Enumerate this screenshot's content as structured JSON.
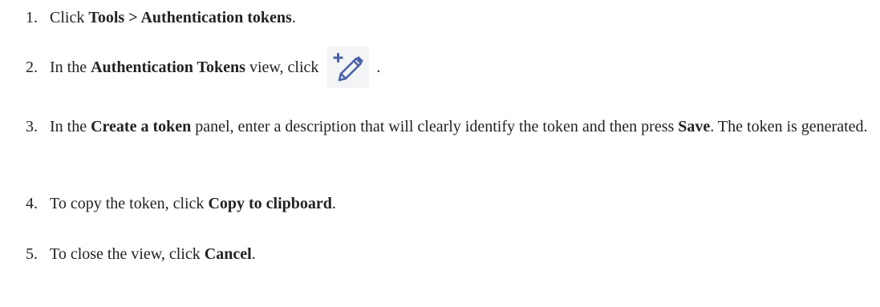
{
  "steps": [
    {
      "number": "1.",
      "parts": [
        "Click ",
        "Tools",
        " > ",
        "Authentication tokens",
        "."
      ]
    },
    {
      "number": "2.",
      "parts": [
        "In the ",
        "Authentication Tokens",
        " view, click ",
        " ."
      ],
      "icon": "add-token-pencil-icon"
    },
    {
      "number": "3.",
      "parts": [
        "In the ",
        "Create a token",
        " panel, enter a description that will clearly identify the token and then press ",
        "Save",
        ". The token is generated."
      ]
    },
    {
      "number": "4.",
      "parts": [
        "To copy the token, click ",
        "Copy to clipboard",
        "."
      ]
    },
    {
      "number": "5.",
      "parts": [
        "To close the view, click ",
        "Cancel",
        "."
      ]
    }
  ],
  "colors": {
    "text": "#222222",
    "icon": "#4a62a8",
    "icon_background": "#f3f4f6"
  }
}
